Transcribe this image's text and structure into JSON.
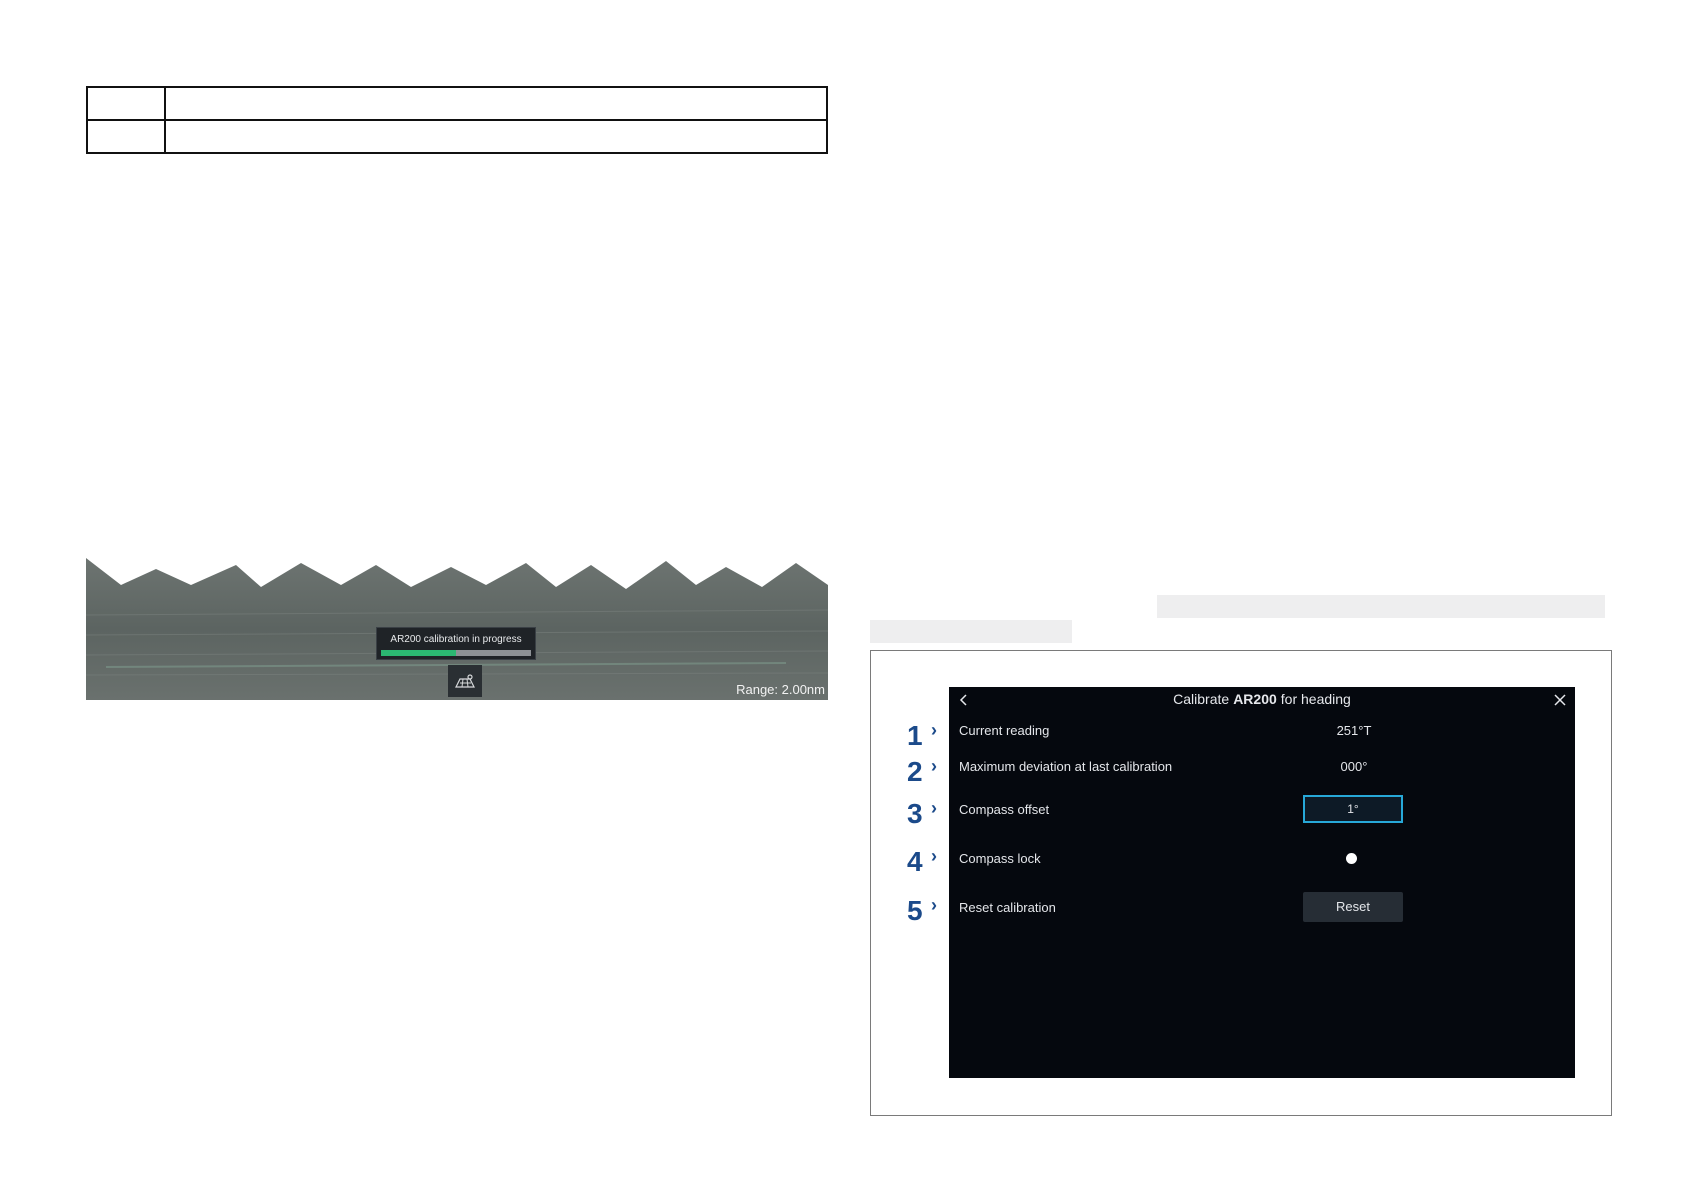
{
  "sea_panel": {
    "banner_text": "AR200 calibration in progress",
    "progress_fraction": 0.5,
    "range_label": "Range: 2.00nm",
    "radar_button_icon": "radar-scan-icon",
    "colors": {
      "progress": "#2bb872",
      "sea": "#5f6763"
    }
  },
  "dialog": {
    "title_prefix": "Calibrate",
    "title_device": "AR200",
    "title_suffix": "for heading",
    "back_icon": "chevron-left-icon",
    "close_icon": "close-icon",
    "rows": [
      {
        "callout": "1",
        "label": "Current reading",
        "value": "251°T"
      },
      {
        "callout": "2",
        "label": "Maximum deviation at last calibration",
        "value": "000°"
      },
      {
        "callout": "3",
        "label": "Compass offset",
        "value": "1°"
      },
      {
        "callout": "4",
        "label": "Compass lock",
        "value": ""
      },
      {
        "callout": "5",
        "label": "Reset calibration",
        "value": "Reset"
      }
    ],
    "colors": {
      "background": "#05080e",
      "focus": "#27a8d8",
      "callout": "#1b4a8a"
    }
  }
}
